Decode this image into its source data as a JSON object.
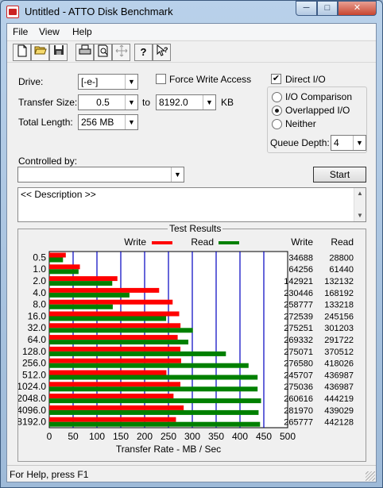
{
  "window": {
    "title": "Untitled - ATTO Disk Benchmark",
    "minimize": "─",
    "maximize": "□",
    "close": "✕"
  },
  "menu": [
    "File",
    "View",
    "Help"
  ],
  "toolbar": [
    "new-icon",
    "open-icon",
    "save-icon",
    "print-icon",
    "print-preview-icon",
    "move-icon",
    "help-icon",
    "context-help-icon"
  ],
  "settings": {
    "drive_label": "Drive:",
    "drive_value": "[-e-]",
    "force_write_label": "Force Write Access",
    "force_write_checked": false,
    "direct_io_label": "Direct I/O",
    "direct_io_checked": true,
    "transfer_size_label": "Transfer Size:",
    "transfer_from": "0.5",
    "to_label": "to",
    "transfer_to": "8192.0",
    "kb_label": "KB",
    "total_length_label": "Total Length:",
    "total_length_value": "256 MB",
    "io_modes": [
      "I/O Comparison",
      "Overlapped I/O",
      "Neither"
    ],
    "io_mode_selected": "Overlapped I/O",
    "queue_depth_label": "Queue Depth:",
    "queue_depth_value": "4",
    "controlled_by_label": "Controlled by:",
    "controlled_by_value": "",
    "start_label": "Start",
    "description": "<< Description >>"
  },
  "chart_data": {
    "type": "bar",
    "title": "Test Results",
    "xlabel": "Transfer Rate - MB / Sec",
    "xlim": [
      0,
      500
    ],
    "x_ticks": [
      "0",
      "50",
      "100",
      "150",
      "200",
      "250",
      "300",
      "350",
      "400",
      "450",
      "500"
    ],
    "categories": [
      "0.5",
      "1.0",
      "2.0",
      "4.0",
      "8.0",
      "16.0",
      "32.0",
      "64.0",
      "128.0",
      "256.0",
      "512.0",
      "1024.0",
      "2048.0",
      "4096.0",
      "8192.0"
    ],
    "series": [
      {
        "name": "Write",
        "color": "#ff0000",
        "values": [
          34688,
          64256,
          142921,
          230446,
          258777,
          272539,
          275251,
          269332,
          275071,
          276580,
          245707,
          275036,
          260616,
          281970,
          265777
        ]
      },
      {
        "name": "Read",
        "color": "#008000",
        "values": [
          28800,
          61440,
          132132,
          168192,
          133218,
          245156,
          301203,
          291722,
          370512,
          418026,
          436987,
          436987,
          444219,
          439029,
          442128
        ]
      }
    ],
    "table_headers": [
      "Write",
      "Read"
    ],
    "grid": true,
    "legend": "top"
  },
  "status": "For Help, press F1",
  "colors": {
    "grid_line": "#0000c0",
    "plot_bg": "#ffffff"
  }
}
